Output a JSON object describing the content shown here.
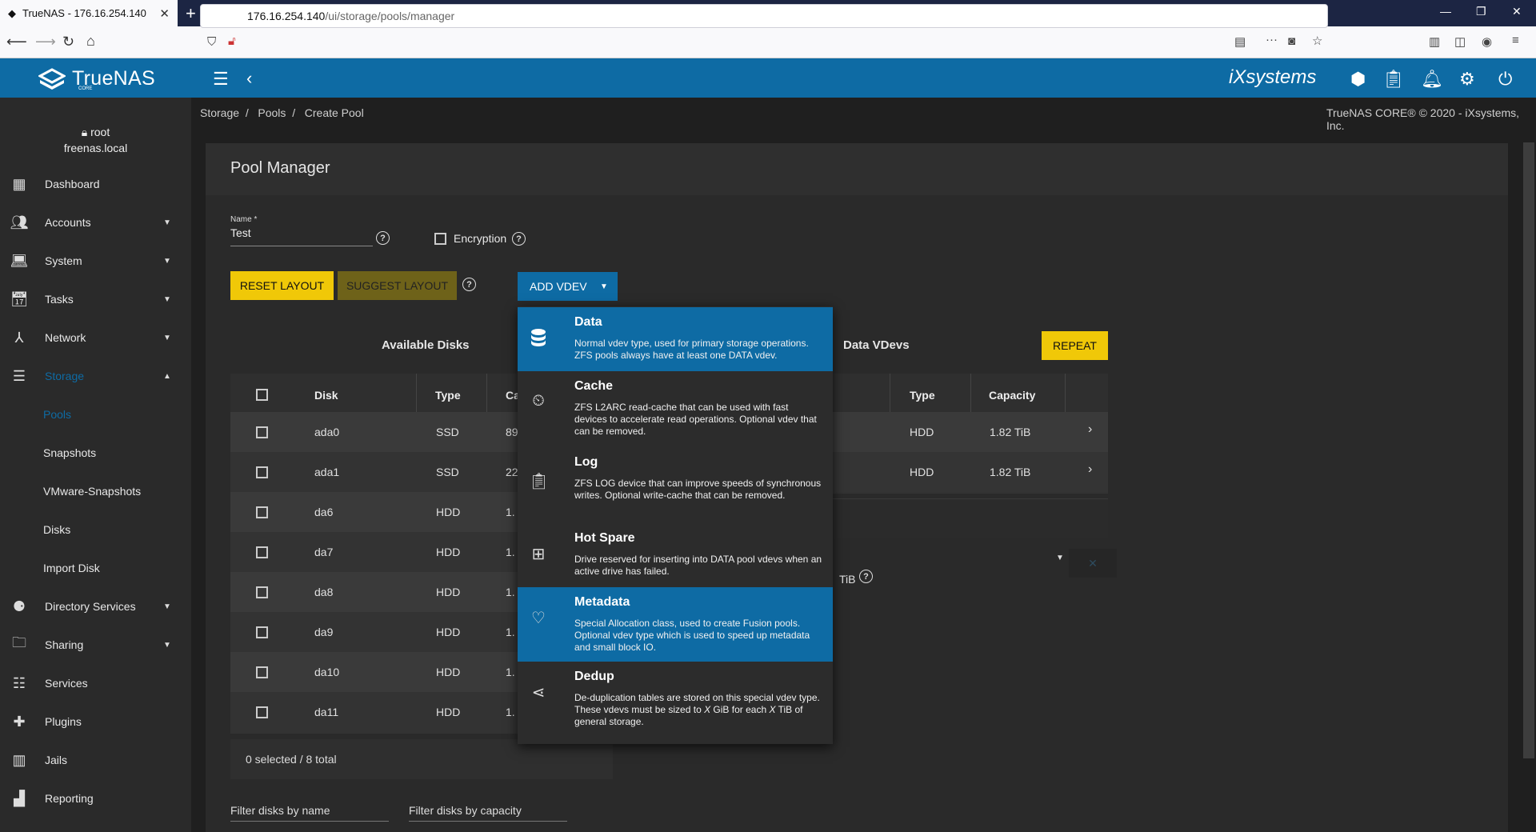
{
  "browser": {
    "tab_title": "TrueNAS - 176.16.254.140",
    "url_host": "176.16.254.140",
    "url_path": "/ui/storage/pools/manager"
  },
  "header": {
    "brand": "TrueNAS",
    "brand_sub": "CORE",
    "vendor": "iXsystems"
  },
  "user": {
    "name": "root",
    "host": "freenas.local"
  },
  "sidebar": {
    "items": [
      {
        "label": "Dashboard",
        "icon": "dashboard-icon"
      },
      {
        "label": "Accounts",
        "icon": "people-icon"
      },
      {
        "label": "System",
        "icon": "laptop-icon"
      },
      {
        "label": "Tasks",
        "icon": "calendar-icon"
      },
      {
        "label": "Network",
        "icon": "network-icon"
      },
      {
        "label": "Storage",
        "icon": "storage-icon"
      },
      {
        "label": "Directory Services",
        "icon": "directory-icon"
      },
      {
        "label": "Sharing",
        "icon": "folder-share-icon"
      },
      {
        "label": "Services",
        "icon": "tune-icon"
      },
      {
        "label": "Plugins",
        "icon": "puzzle-icon"
      },
      {
        "label": "Jails",
        "icon": "jail-icon"
      },
      {
        "label": "Reporting",
        "icon": "chart-icon"
      }
    ],
    "storage_sub": [
      "Pools",
      "Snapshots",
      "VMware-Snapshots",
      "Disks",
      "Import Disk"
    ],
    "accent": "#0e6ba4"
  },
  "breadcrumb": {
    "storage": "Storage",
    "pools": "Pools",
    "current": "Create Pool",
    "sep": "/"
  },
  "copyright": "TrueNAS CORE® © 2020 - iXsystems, Inc.",
  "pool": {
    "title": "Pool Manager",
    "name_label": "Name *",
    "name_value": "Test",
    "encryption_label": "Encryption",
    "reset_label": "RESET LAYOUT",
    "suggest_label": "SUGGEST LAYOUT",
    "add_vdev_label": "ADD VDEV",
    "available_disks": "Available Disks",
    "data_vdevs": "Data VDevs",
    "repeat_label": "REPEAT",
    "selected_text": "0 selected / 8 total",
    "filter_name": "Filter disks by name",
    "filter_capacity": "Filter disks by capacity",
    "size_unit": "TiB"
  },
  "disk_table": {
    "headers": [
      "Disk",
      "Type",
      "Ca"
    ],
    "rows": [
      {
        "disk": "ada0",
        "type": "SSD",
        "cap": "89"
      },
      {
        "disk": "ada1",
        "type": "SSD",
        "cap": "22"
      },
      {
        "disk": "da6",
        "type": "HDD",
        "cap": "1."
      },
      {
        "disk": "da7",
        "type": "HDD",
        "cap": "1."
      },
      {
        "disk": "da8",
        "type": "HDD",
        "cap": "1."
      },
      {
        "disk": "da9",
        "type": "HDD",
        "cap": "1."
      },
      {
        "disk": "da10",
        "type": "HDD",
        "cap": "1."
      },
      {
        "disk": "da11",
        "type": "HDD",
        "cap": "1."
      }
    ]
  },
  "vdev_table": {
    "headers": [
      "Type",
      "Capacity"
    ],
    "rows": [
      {
        "type": "HDD",
        "cap": "1.82 TiB"
      },
      {
        "type": "HDD",
        "cap": "1.82 TiB"
      }
    ]
  },
  "vdev_menu": [
    {
      "title": "Data",
      "icon": "database-icon",
      "desc": "Normal vdev type, used for primary storage operations. ZFS pools always have at least one DATA vdev."
    },
    {
      "title": "Cache",
      "icon": "cache-history-icon",
      "desc": "ZFS L2ARC read-cache that can be used with fast devices to accelerate read operations. Optional vdev that can be removed."
    },
    {
      "title": "Log",
      "icon": "clipboard-icon",
      "desc": "ZFS LOG device that can improve speeds of synchronous writes. Optional write-cache that can be removed."
    },
    {
      "title": "Hot Spare",
      "icon": "plus-box-icon",
      "desc": "Drive reserved for inserting into DATA pool vdevs when an active drive has failed."
    },
    {
      "title": "Metadata",
      "icon": "heart-icon",
      "desc": "Special Allocation class, used to create Fusion pools. Optional vdev type which is used to speed up metadata and small block IO."
    },
    {
      "title": "Dedup",
      "icon": "share-icon",
      "desc_pre": "De-duplication tables are stored on this special vdev type. These vdevs must be sized to ",
      "desc_x1": "X",
      "desc_mid": " GiB for each ",
      "desc_x2": "X",
      "desc_post": " TiB of general storage."
    }
  ]
}
